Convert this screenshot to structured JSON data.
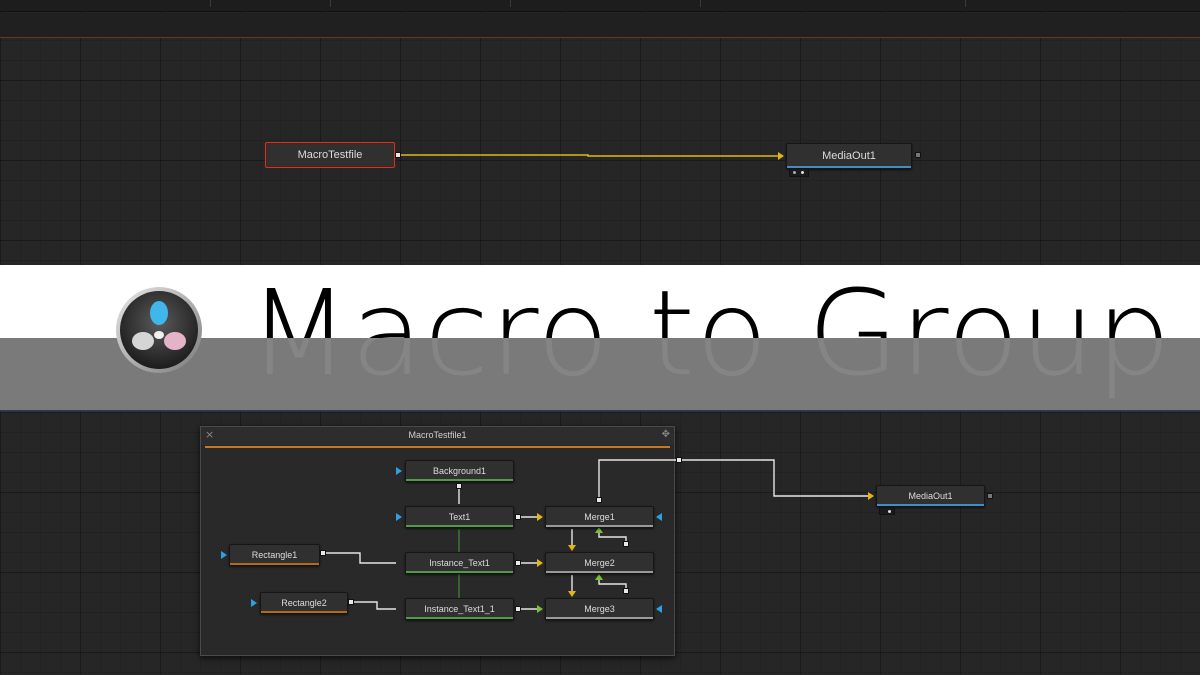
{
  "top_view": {
    "nodes": {
      "macro": "MacroTestfile",
      "media_out": "MediaOut1"
    }
  },
  "banner": {
    "title": "Macro to Group",
    "logo_icon": "davinci-resolve-logo-icon"
  },
  "bottom_view": {
    "group": {
      "title": "MacroTestfile1",
      "close_icon": "close-icon",
      "move_icon": "move-icon"
    },
    "nodes": {
      "background1": "Background1",
      "text1": "Text1",
      "instance_text1": "Instance_Text1",
      "instance_text1_1": "Instance_Text1_1",
      "merge1": "Merge1",
      "merge2": "Merge2",
      "merge3": "Merge3",
      "rectangle1": "Rectangle1",
      "rectangle2": "Rectangle2",
      "media_out": "MediaOut1"
    }
  },
  "colors": {
    "link_yellow": "#e2b713",
    "link_white": "#e6e6e6",
    "link_green": "#7bbf3a",
    "input_blue": "#2e9fe0",
    "selected_red": "#c23b2a",
    "group_orange": "#c57a22"
  }
}
